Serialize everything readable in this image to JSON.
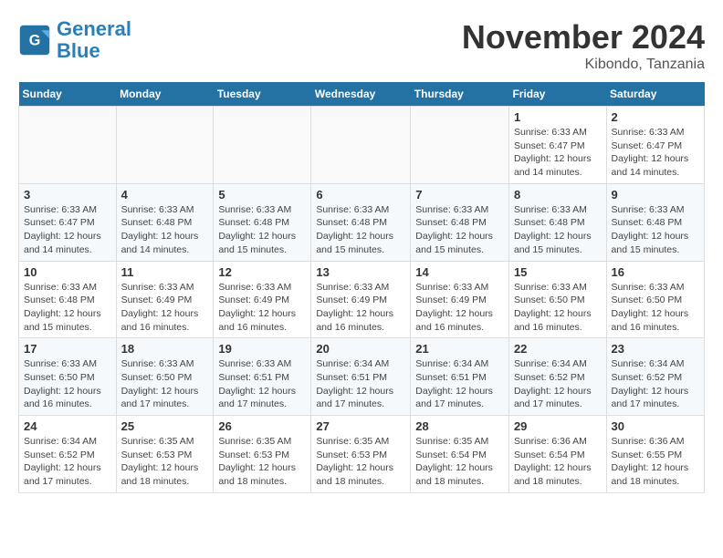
{
  "logo": {
    "line1": "General",
    "line2": "Blue"
  },
  "title": "November 2024",
  "location": "Kibondo, Tanzania",
  "days_of_week": [
    "Sunday",
    "Monday",
    "Tuesday",
    "Wednesday",
    "Thursday",
    "Friday",
    "Saturday"
  ],
  "weeks": [
    [
      {
        "day": "",
        "info": ""
      },
      {
        "day": "",
        "info": ""
      },
      {
        "day": "",
        "info": ""
      },
      {
        "day": "",
        "info": ""
      },
      {
        "day": "",
        "info": ""
      },
      {
        "day": "1",
        "info": "Sunrise: 6:33 AM\nSunset: 6:47 PM\nDaylight: 12 hours and 14 minutes."
      },
      {
        "day": "2",
        "info": "Sunrise: 6:33 AM\nSunset: 6:47 PM\nDaylight: 12 hours and 14 minutes."
      }
    ],
    [
      {
        "day": "3",
        "info": "Sunrise: 6:33 AM\nSunset: 6:47 PM\nDaylight: 12 hours and 14 minutes."
      },
      {
        "day": "4",
        "info": "Sunrise: 6:33 AM\nSunset: 6:48 PM\nDaylight: 12 hours and 14 minutes."
      },
      {
        "day": "5",
        "info": "Sunrise: 6:33 AM\nSunset: 6:48 PM\nDaylight: 12 hours and 15 minutes."
      },
      {
        "day": "6",
        "info": "Sunrise: 6:33 AM\nSunset: 6:48 PM\nDaylight: 12 hours and 15 minutes."
      },
      {
        "day": "7",
        "info": "Sunrise: 6:33 AM\nSunset: 6:48 PM\nDaylight: 12 hours and 15 minutes."
      },
      {
        "day": "8",
        "info": "Sunrise: 6:33 AM\nSunset: 6:48 PM\nDaylight: 12 hours and 15 minutes."
      },
      {
        "day": "9",
        "info": "Sunrise: 6:33 AM\nSunset: 6:48 PM\nDaylight: 12 hours and 15 minutes."
      }
    ],
    [
      {
        "day": "10",
        "info": "Sunrise: 6:33 AM\nSunset: 6:48 PM\nDaylight: 12 hours and 15 minutes."
      },
      {
        "day": "11",
        "info": "Sunrise: 6:33 AM\nSunset: 6:49 PM\nDaylight: 12 hours and 16 minutes."
      },
      {
        "day": "12",
        "info": "Sunrise: 6:33 AM\nSunset: 6:49 PM\nDaylight: 12 hours and 16 minutes."
      },
      {
        "day": "13",
        "info": "Sunrise: 6:33 AM\nSunset: 6:49 PM\nDaylight: 12 hours and 16 minutes."
      },
      {
        "day": "14",
        "info": "Sunrise: 6:33 AM\nSunset: 6:49 PM\nDaylight: 12 hours and 16 minutes."
      },
      {
        "day": "15",
        "info": "Sunrise: 6:33 AM\nSunset: 6:50 PM\nDaylight: 12 hours and 16 minutes."
      },
      {
        "day": "16",
        "info": "Sunrise: 6:33 AM\nSunset: 6:50 PM\nDaylight: 12 hours and 16 minutes."
      }
    ],
    [
      {
        "day": "17",
        "info": "Sunrise: 6:33 AM\nSunset: 6:50 PM\nDaylight: 12 hours and 16 minutes."
      },
      {
        "day": "18",
        "info": "Sunrise: 6:33 AM\nSunset: 6:50 PM\nDaylight: 12 hours and 17 minutes."
      },
      {
        "day": "19",
        "info": "Sunrise: 6:33 AM\nSunset: 6:51 PM\nDaylight: 12 hours and 17 minutes."
      },
      {
        "day": "20",
        "info": "Sunrise: 6:34 AM\nSunset: 6:51 PM\nDaylight: 12 hours and 17 minutes."
      },
      {
        "day": "21",
        "info": "Sunrise: 6:34 AM\nSunset: 6:51 PM\nDaylight: 12 hours and 17 minutes."
      },
      {
        "day": "22",
        "info": "Sunrise: 6:34 AM\nSunset: 6:52 PM\nDaylight: 12 hours and 17 minutes."
      },
      {
        "day": "23",
        "info": "Sunrise: 6:34 AM\nSunset: 6:52 PM\nDaylight: 12 hours and 17 minutes."
      }
    ],
    [
      {
        "day": "24",
        "info": "Sunrise: 6:34 AM\nSunset: 6:52 PM\nDaylight: 12 hours and 17 minutes."
      },
      {
        "day": "25",
        "info": "Sunrise: 6:35 AM\nSunset: 6:53 PM\nDaylight: 12 hours and 18 minutes."
      },
      {
        "day": "26",
        "info": "Sunrise: 6:35 AM\nSunset: 6:53 PM\nDaylight: 12 hours and 18 minutes."
      },
      {
        "day": "27",
        "info": "Sunrise: 6:35 AM\nSunset: 6:53 PM\nDaylight: 12 hours and 18 minutes."
      },
      {
        "day": "28",
        "info": "Sunrise: 6:35 AM\nSunset: 6:54 PM\nDaylight: 12 hours and 18 minutes."
      },
      {
        "day": "29",
        "info": "Sunrise: 6:36 AM\nSunset: 6:54 PM\nDaylight: 12 hours and 18 minutes."
      },
      {
        "day": "30",
        "info": "Sunrise: 6:36 AM\nSunset: 6:55 PM\nDaylight: 12 hours and 18 minutes."
      }
    ]
  ]
}
